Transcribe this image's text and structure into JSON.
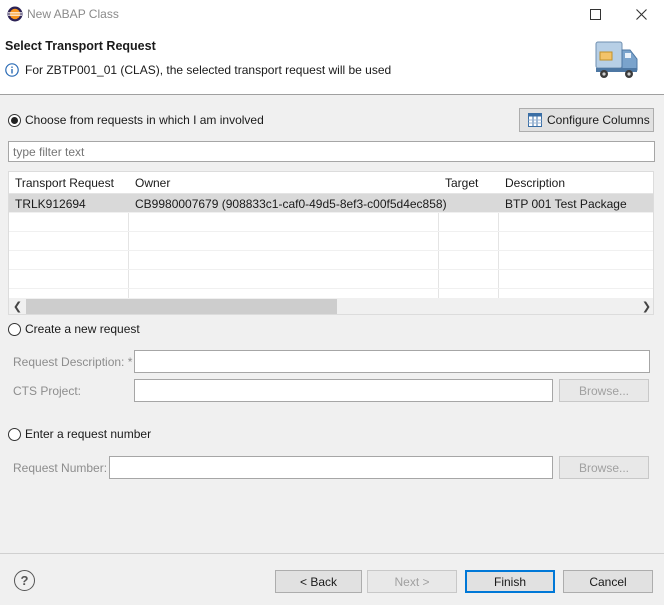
{
  "window": {
    "title": "New ABAP Class"
  },
  "header": {
    "title": "Select Transport Request",
    "message": "For ZBTP001_01 (CLAS), the selected transport request will be used"
  },
  "involved": {
    "radio_label": "Choose from requests in which I am involved",
    "configure_columns": "Configure Columns",
    "filter_placeholder": "type filter text",
    "columns": [
      "Transport Request",
      "Owner",
      "Target",
      "Description"
    ],
    "rows": [
      {
        "request": "TRLK912694",
        "owner": "CB9980007679 (908833c1-caf0-49d5-8ef3-c00f5d4ec858)",
        "target": "",
        "description": "BTP 001 Test Package"
      }
    ]
  },
  "create_new": {
    "radio_label": "Create a new request",
    "request_description_label": "Request Description: *",
    "request_description_value": "",
    "cts_project_label": "CTS Project:",
    "cts_project_value": "",
    "browse_label": "Browse..."
  },
  "enter_number": {
    "radio_label": "Enter a request number",
    "request_number_label": "Request Number:",
    "request_number_value": "",
    "browse_label": "Browse..."
  },
  "footer": {
    "back_label": "< Back",
    "next_label": "Next >",
    "finish_label": "Finish",
    "cancel_label": "Cancel"
  }
}
